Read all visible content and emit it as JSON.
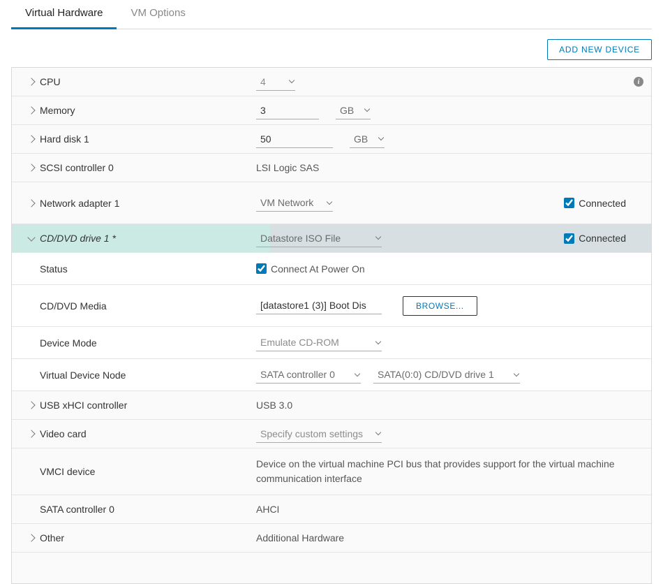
{
  "tabs": {
    "virtual_hardware": "Virtual Hardware",
    "vm_options": "VM Options"
  },
  "actions": {
    "add_new_device": "ADD NEW DEVICE",
    "browse": "BROWSE..."
  },
  "cpu": {
    "label": "CPU",
    "value": "4"
  },
  "memory": {
    "label": "Memory",
    "value": "3",
    "unit": "GB"
  },
  "hard_disk": {
    "label": "Hard disk 1",
    "value": "50",
    "unit": "GB"
  },
  "scsi": {
    "label": "SCSI controller 0",
    "value": "LSI Logic SAS"
  },
  "network": {
    "label": "Network adapter 1",
    "value": "VM Network",
    "connected": "Connected"
  },
  "cd": {
    "label": "CD/DVD drive 1 *",
    "value": "Datastore ISO File",
    "connected": "Connected",
    "status_label": "Status",
    "status_value": "Connect At Power On",
    "media_label": "CD/DVD Media",
    "media_value": "[datastore1 (3)] Boot Dis",
    "device_mode_label": "Device Mode",
    "device_mode_value": "Emulate CD-ROM",
    "vdn_label": "Virtual Device Node",
    "vdn_controller": "SATA controller 0",
    "vdn_port": "SATA(0:0) CD/DVD drive 1"
  },
  "usb": {
    "label": "USB xHCI controller",
    "value": "USB 3.0"
  },
  "video": {
    "label": "Video card",
    "value": "Specify custom settings"
  },
  "vmci": {
    "label": "VMCI device",
    "value": "Device on the virtual machine PCI bus that provides support for the virtual machine communication interface"
  },
  "sata": {
    "label": "SATA controller 0",
    "value": "AHCI"
  },
  "other": {
    "label": "Other",
    "value": "Additional Hardware"
  }
}
